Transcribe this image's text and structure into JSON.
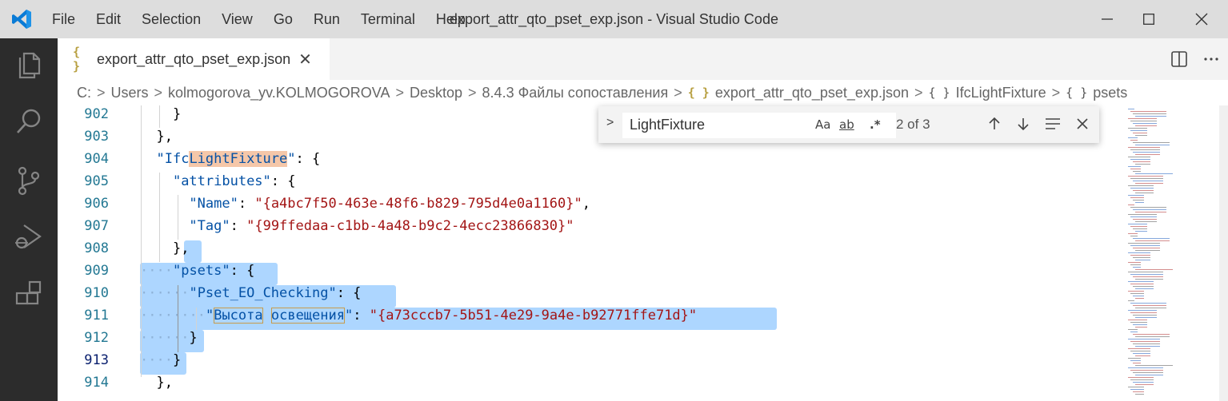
{
  "window": {
    "title": "export_attr_qto_pset_exp.json - Visual Studio Code",
    "menu": [
      "File",
      "Edit",
      "Selection",
      "View",
      "Go",
      "Run",
      "Terminal",
      "Help"
    ],
    "controls": [
      "minimize-icon",
      "maximize-icon",
      "close-icon"
    ]
  },
  "activity_bar": [
    "explorer-icon",
    "search-icon",
    "source-control-icon",
    "run-debug-icon",
    "extensions-icon"
  ],
  "tab": {
    "icon": "{ }",
    "label": "export_attr_qto_pset_exp.json",
    "close": "✕"
  },
  "breadcrumb": [
    {
      "text": "C:",
      "icon": ""
    },
    {
      "text": "Users",
      "icon": ""
    },
    {
      "text": "kolmogorova_yv.KOLMOGOROVA",
      "icon": ""
    },
    {
      "text": "Desktop",
      "icon": ""
    },
    {
      "text": "8.4.3 Файлы сопоставления",
      "icon": ""
    },
    {
      "text": "export_attr_qto_pset_exp.json",
      "icon": "{ }"
    },
    {
      "text": "IfcLightFixture",
      "icon": "{ }"
    },
    {
      "text": "psets",
      "icon": "{ }"
    }
  ],
  "find_widget": {
    "query": "LightFixture",
    "match_case": "Aa",
    "whole_word": "ab",
    "regex": ".*",
    "count": "2 of 3"
  },
  "editor": {
    "current_line": "913",
    "lines": [
      {
        "num": "902",
        "indent": 2,
        "code": "}"
      },
      {
        "num": "903",
        "indent": 1,
        "code": "},"
      },
      {
        "num": "904",
        "indent": 1,
        "code": "\"IfcLightFixture\": {"
      },
      {
        "num": "905",
        "indent": 2,
        "code": "\"attributes\": {"
      },
      {
        "num": "906",
        "indent": 3,
        "code": "\"Name\": \"{a4bc7f50-463e-48f6-b829-795d4e0a1160}\","
      },
      {
        "num": "907",
        "indent": 3,
        "code": "\"Tag\": \"{99ffedaa-c1bb-4a48-b9c2-4ecc23866830}\""
      },
      {
        "num": "908",
        "indent": 2,
        "code": "},"
      },
      {
        "num": "909",
        "indent": 2,
        "code": "\"psets\": {"
      },
      {
        "num": "910",
        "indent": 3,
        "code": "\"Pset_EO_Checking\": {"
      },
      {
        "num": "911",
        "indent": 4,
        "code": "\"Высота освещения\": \"{a73cccb7-5b51-4e29-9a4e-b92771ffe71d}\""
      },
      {
        "num": "912",
        "indent": 3,
        "code": "}"
      },
      {
        "num": "913",
        "indent": 2,
        "code": "}"
      },
      {
        "num": "914",
        "indent": 1,
        "code": "},"
      }
    ]
  },
  "colors": {
    "key": "#0451a5",
    "string": "#a31515",
    "line_number": "#237893",
    "selection": "#add6ff",
    "find_highlight": "#f5c7a9",
    "activity_bar": "#2c2c2c",
    "title_bar": "#dddddd"
  }
}
